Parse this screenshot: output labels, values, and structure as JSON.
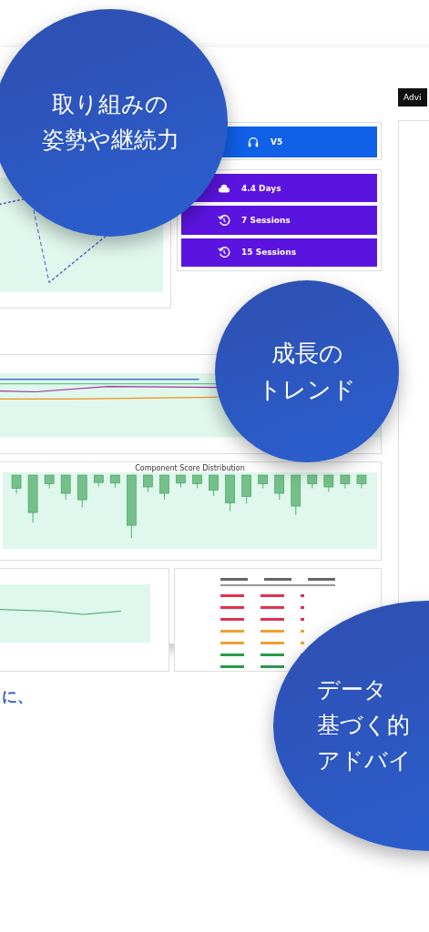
{
  "side_panel": {
    "label": "Advi"
  },
  "stat_tiles": [
    {
      "kind": "headphones",
      "value": "V5",
      "color": "#1060e8"
    },
    {
      "kind": "cloud",
      "value": "4.4 Days",
      "color": "#5b14e0"
    },
    {
      "kind": "history",
      "value": "7 Sessions",
      "color": "#5b14e0"
    },
    {
      "kind": "history",
      "value": "15 Sessions",
      "color": "#5b14e0"
    }
  ],
  "box_chart": {
    "title": "Component Score Distribution"
  },
  "score_table": {
    "rows": [
      {
        "color": "#e0304a"
      },
      {
        "color": "#e0304a"
      },
      {
        "color": "#e0304a"
      },
      {
        "color": "#f0a030"
      },
      {
        "color": "#f0a030"
      },
      {
        "color": "#2a9a4a"
      },
      {
        "color": "#2a9a4a"
      }
    ]
  },
  "bubbles": [
    {
      "kind": "top-left",
      "lines": [
        "取り組みの",
        "姿勢や継続力"
      ]
    },
    {
      "kind": "middle-right",
      "lines": [
        "成長の",
        "トレンド"
      ]
    },
    {
      "kind": "bottom-right",
      "lines": [
        "データ",
        "基づく的",
        "アドバイ"
      ]
    }
  ],
  "caption": "に、"
}
